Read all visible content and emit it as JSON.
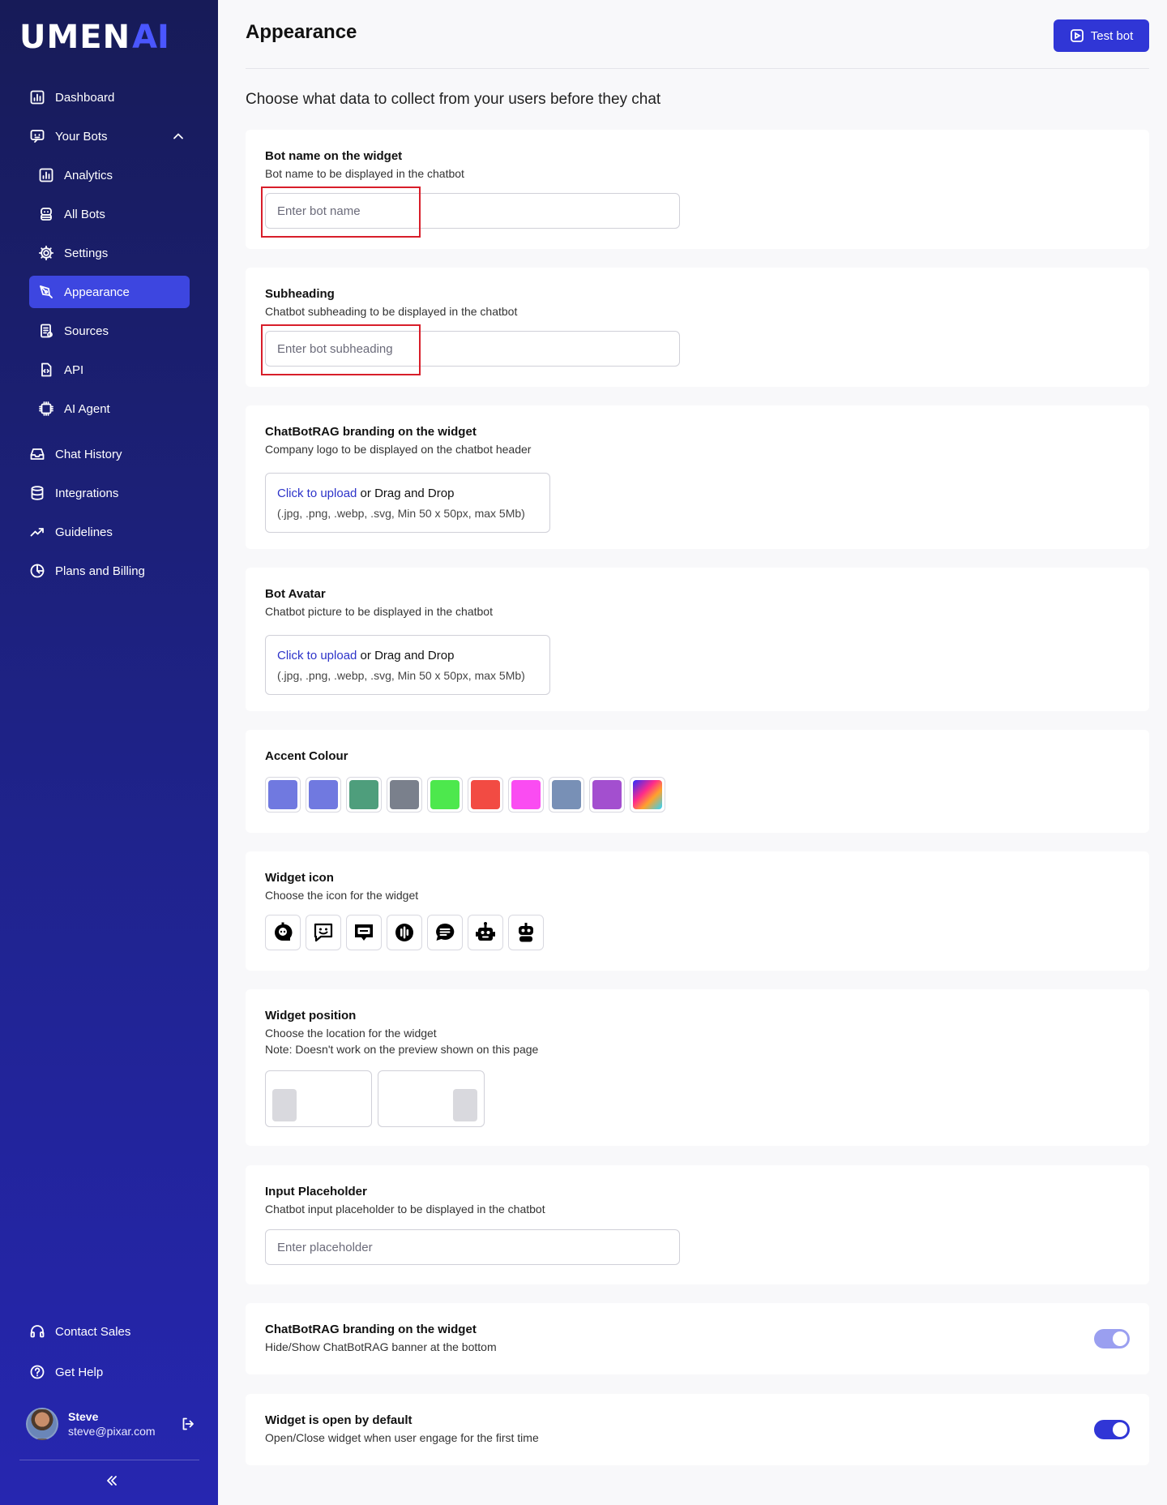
{
  "brand": {
    "logo_text": "UMEN",
    "logo_ai": "AI"
  },
  "sidebar": {
    "nav": [
      {
        "label": "Dashboard",
        "icon": "chart-icon"
      },
      {
        "label": "Your Bots",
        "icon": "bot-icon"
      },
      {
        "label": "Analytics",
        "icon": "chart-icon"
      },
      {
        "label": "All Bots",
        "icon": "bot-icon"
      },
      {
        "label": "Settings",
        "icon": "gear-icon"
      },
      {
        "label": "Appearance",
        "icon": "brush-icon"
      },
      {
        "label": "Sources",
        "icon": "document-icon"
      },
      {
        "label": "API",
        "icon": "code-file-icon"
      },
      {
        "label": "AI Agent",
        "icon": "chip-icon"
      },
      {
        "label": "Chat History",
        "icon": "inbox-icon"
      },
      {
        "label": "Integrations",
        "icon": "database-icon"
      },
      {
        "label": "Guidelines",
        "icon": "trend-icon"
      },
      {
        "label": "Plans and Billing",
        "icon": "billing-icon"
      }
    ],
    "bottom": [
      {
        "label": "Contact Sales",
        "icon": "headset-icon"
      },
      {
        "label": "Get Help",
        "icon": "help-icon"
      }
    ],
    "user": {
      "name": "Steve",
      "email": "steve@pixar.com"
    }
  },
  "header": {
    "title": "Appearance",
    "test_button": "Test bot"
  },
  "intro": "Choose what data to collect from your users before they chat",
  "bot_name": {
    "label": "Bot name on the widget",
    "desc": "Bot name to be displayed in the chatbot",
    "placeholder": "Enter bot name"
  },
  "subheading": {
    "label": "Subheading",
    "desc": "Chatbot subheading to be displayed in the chatbot",
    "placeholder": "Enter bot subheading"
  },
  "branding_logo": {
    "label": "ChatBotRAG branding on the widget",
    "desc": "Company logo to be displayed on the chatbot header",
    "upload_link": "Click to upload",
    "upload_rest": " or Drag and Drop",
    "upload_formats": "(.jpg, .png, .webp, .svg, Min 50 x 50px, max 5Mb)"
  },
  "bot_avatar": {
    "label": "Bot Avatar",
    "desc": "Chatbot picture to be displayed in the chatbot",
    "upload_link": "Click to upload",
    "upload_rest": " or Drag and Drop",
    "upload_formats": "(.jpg, .png, .webp, .svg, Min 50 x 50px, max 5Mb)"
  },
  "accent": {
    "label": "Accent Colour",
    "colors": [
      "#7079e0",
      "#7079e0",
      "#4e9e7c",
      "#7a808c",
      "#4de84d",
      "#f24b43",
      "#fa4cf2",
      "#7890b6",
      "#a34fcf",
      "gradient"
    ]
  },
  "widget_icon": {
    "label": "Widget icon",
    "desc": "Choose the icon for the widget",
    "icons": [
      "bot-face-icon",
      "chat-smile-icon",
      "chat-bubble-icon",
      "voice-icon",
      "message-lines-icon",
      "robot-icon",
      "robot-head-icon"
    ]
  },
  "widget_position": {
    "label": "Widget position",
    "desc": "Choose the location for the widget",
    "note": "Note: Doesn't work on the preview shown on this page",
    "options": [
      "left",
      "right"
    ]
  },
  "input_placeholder": {
    "label": "Input Placeholder",
    "desc": "Chatbot input placeholder to be displayed in the chatbot",
    "placeholder": "Enter placeholder"
  },
  "branding_toggle": {
    "label": "ChatBotRAG branding on the widget",
    "desc": "Hide/Show ChatBotRAG banner at the bottom",
    "on": true,
    "color": "#9a9ff0"
  },
  "open_default": {
    "label": "Widget is open by default",
    "desc": "Open/Close widget when user engage for the first time",
    "on": true,
    "color": "#3036d6"
  }
}
